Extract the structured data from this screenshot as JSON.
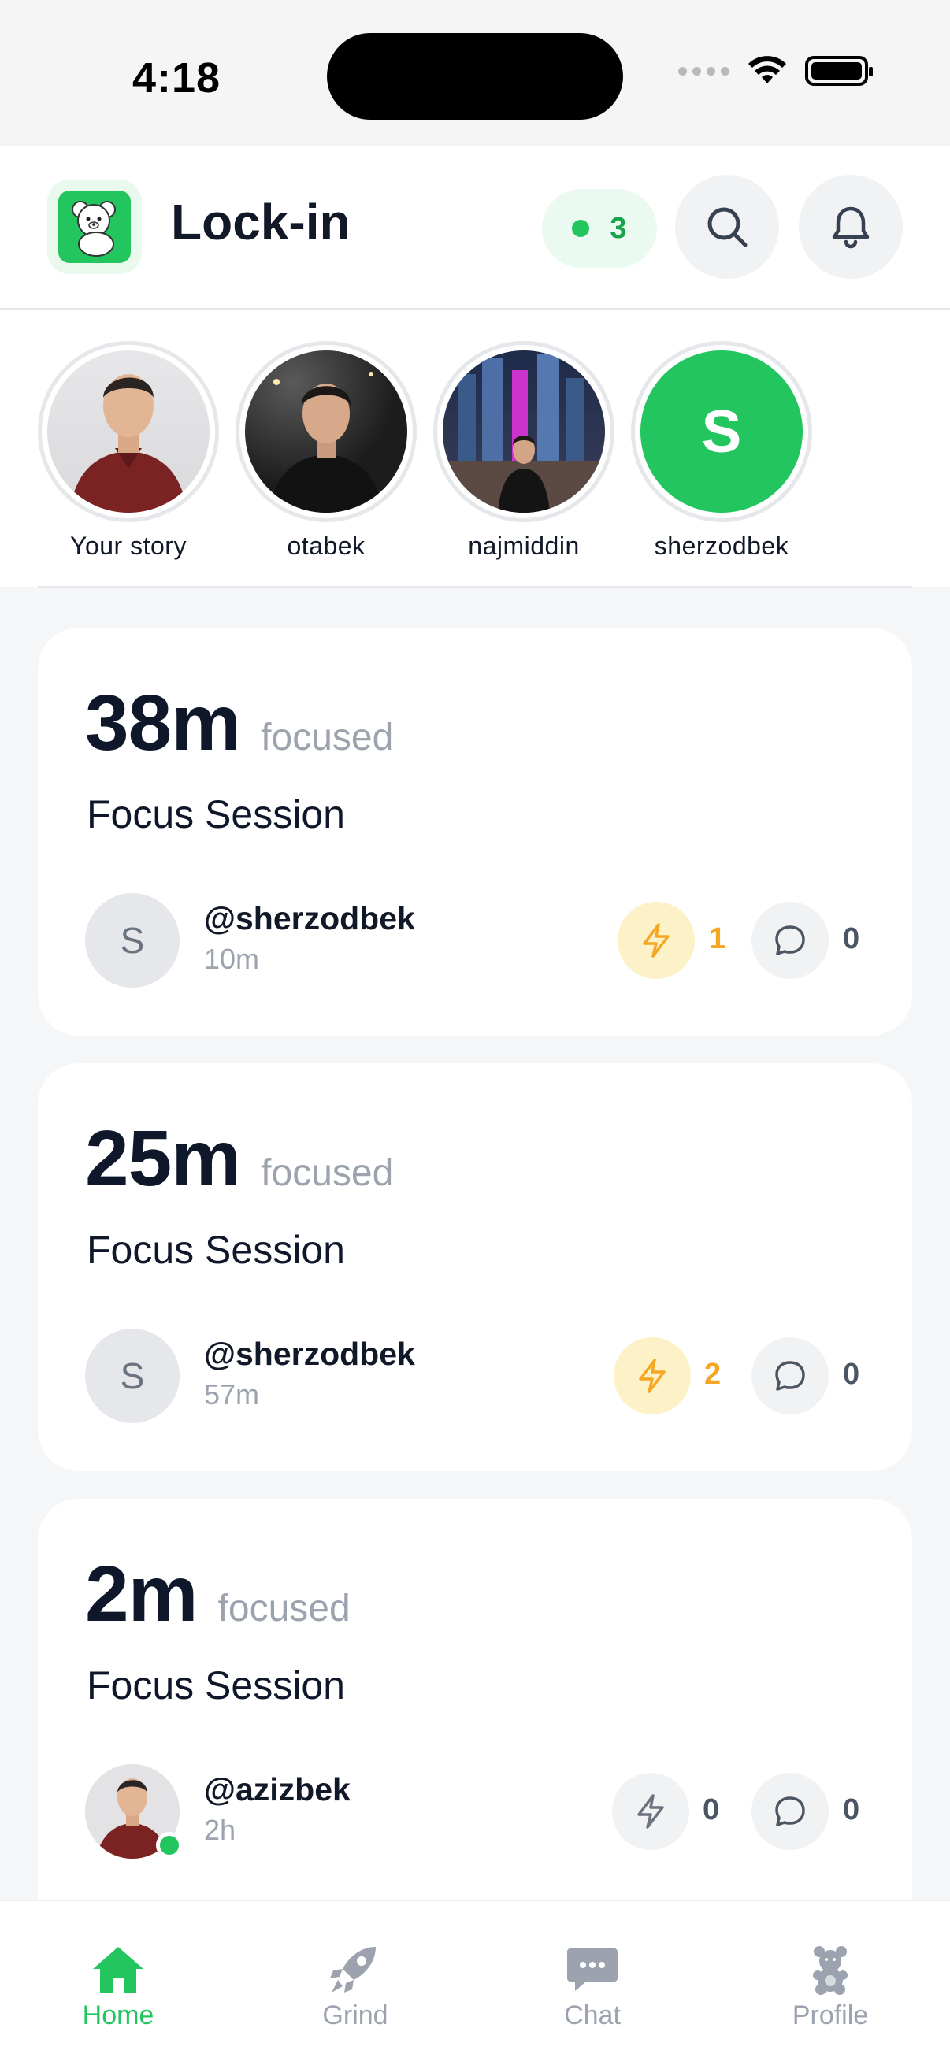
{
  "status_bar": {
    "time": "4:18"
  },
  "header": {
    "title": "Lock-in",
    "online_count": "3"
  },
  "stories": [
    {
      "name": "Your story"
    },
    {
      "name": "otabek"
    },
    {
      "name": "najmiddin"
    },
    {
      "name": "sherzodbek",
      "initial": "S"
    }
  ],
  "feed": [
    {
      "duration": "38m",
      "focused_label": "focused",
      "title": "Focus Session",
      "avatar_initial": "S",
      "handle": "@sherzodbek",
      "ago": "10m",
      "bolts": "1",
      "comments": "0"
    },
    {
      "duration": "25m",
      "focused_label": "focused",
      "title": "Focus Session",
      "avatar_initial": "S",
      "handle": "@sherzodbek",
      "ago": "57m",
      "bolts": "2",
      "comments": "0"
    },
    {
      "duration": "2m",
      "focused_label": "focused",
      "title": "Focus Session",
      "handle": "@azizbek",
      "ago": "2h",
      "bolts": "0",
      "comments": "0"
    }
  ],
  "tabs": [
    {
      "label": "Home",
      "icon": "home-icon",
      "active": true
    },
    {
      "label": "Grind",
      "icon": "rocket-icon",
      "active": false
    },
    {
      "label": "Chat",
      "icon": "chat-bubble-icon",
      "active": false
    },
    {
      "label": "Profile",
      "icon": "teddy-bear-icon",
      "active": false
    }
  ],
  "colors": {
    "accent": "#22c55e",
    "bolt_active": "#f5a623",
    "bolt_active_bg": "#fdf1c7",
    "inactive": "#9ca3af"
  }
}
